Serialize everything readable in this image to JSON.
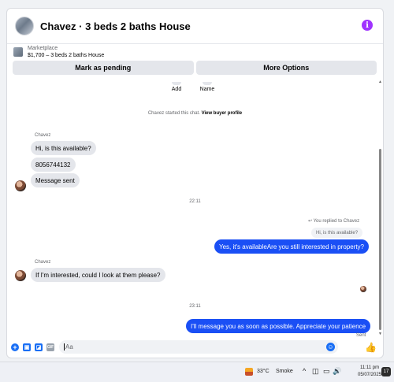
{
  "header": {
    "title": "Chavez · 3 beds 2 baths House",
    "info_icon": "i"
  },
  "listing": {
    "source": "Marketplace",
    "price_summary": "$1,700 – 3 beds 2 baths House"
  },
  "actions": {
    "mark_pending": "Mark as pending",
    "more_options": "More Options"
  },
  "profile_actions": {
    "add": "Add",
    "name": "Name"
  },
  "system_message": {
    "prefix": "Chavez started this chat.",
    "link": "View buyer profile"
  },
  "conversation": {
    "sender_name_1": "Chavez",
    "in_msg_1": "Hi, is this available?",
    "in_msg_2": "8056744132",
    "in_msg_3": "Message sent",
    "time_1": "22:11",
    "reply_label": "You replied to Chavez",
    "quoted": "Hi, is this available?",
    "out_msg_1": "Yes, it's availableAre you still interested in property?",
    "sender_name_2": "Chavez",
    "in_msg_4": "If I'm interested, could I look at them please?",
    "time_2": "23:11",
    "out_msg_2": "I'll message you as soon as possible. Appreciate your patience",
    "sent_status": "Sent"
  },
  "composer": {
    "placeholder": "Aa",
    "icons": [
      "plus-icon",
      "photo-icon",
      "sticker-icon",
      "gif-icon",
      "emoji-icon",
      "like-icon"
    ]
  },
  "taskbar": {
    "temperature": "33°C",
    "condition": "Smoke",
    "time": "11:11 pm",
    "date": "05/07/2025",
    "notification_count": "17"
  },
  "colors": {
    "outgoing_bubble": "#1a4ff5",
    "accent": "#1a6ff5",
    "info_purple": "#a033ff"
  }
}
